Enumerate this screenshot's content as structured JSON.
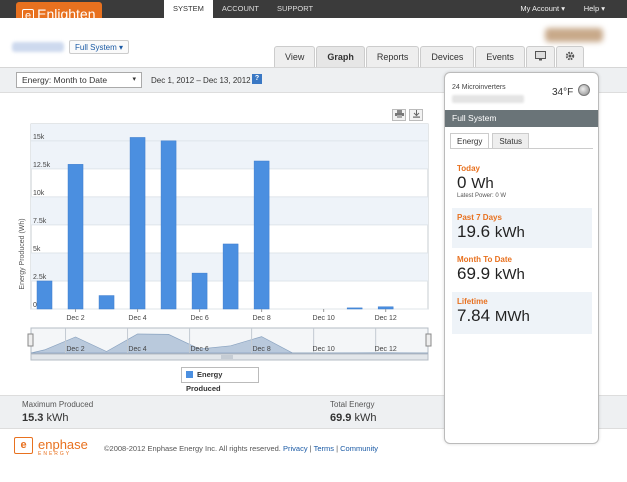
{
  "app": {
    "logo_bracket": "e",
    "logo_text": "Enlighten"
  },
  "nav": {
    "tabs": [
      "SYSTEM",
      "ACCOUNT",
      "SUPPORT"
    ],
    "active": 0,
    "my_account": "My Account ▾",
    "help": "Help ▾"
  },
  "header": {
    "system_menu": "Full System ▾"
  },
  "view_tabs": [
    "View",
    "Graph",
    "Reports",
    "Devices",
    "Events"
  ],
  "view_active": "Graph",
  "filter": {
    "energy_select": "Energy: Month to Date",
    "caret": "▾",
    "date_range": "Dec 1, 2012 – Dec 13, 2012",
    "help_icon": "?"
  },
  "legend": {
    "label": "Energy Produced"
  },
  "stats": {
    "max_label": "Maximum Produced",
    "max_value": "15.3",
    "max_unit": "kWh",
    "total_label": "Total Energy",
    "total_value": "69.9",
    "total_unit": "kWh"
  },
  "footer": {
    "logo_bracket": "e",
    "logo_text": "enphase",
    "logo_sub": "ENERGY",
    "copyright": "©2008-2012 Enphase Energy Inc. All rights reserved.",
    "privacy": "Privacy",
    "terms": "Terms",
    "community": "Community"
  },
  "right_panel": {
    "microinverters": "24 Microinverters",
    "temperature": "34°F",
    "title": "Full System",
    "tabs": [
      "Energy",
      "Status"
    ],
    "today_label": "Today",
    "today_value": "0",
    "today_unit": "Wh",
    "latest_power": "Latest Power: 0 W",
    "week_label": "Past 7 Days",
    "week_value": "19.6",
    "week_unit": "kWh",
    "month_label": "Month To Date",
    "month_value": "69.9",
    "month_unit": "kWh",
    "lifetime_label": "Lifetime",
    "lifetime_value": "7.84",
    "lifetime_unit": "MWh"
  },
  "colors": {
    "accent": "#e8711f",
    "bar": "#4b8fe0",
    "topbar": "#3b3b3b"
  },
  "chart_data": {
    "type": "bar",
    "ylabel": "Energy Produced (Wh)",
    "ylim": [
      0,
      16500
    ],
    "y_ticks": [
      0,
      2500,
      5000,
      7500,
      10000,
      12500,
      15000
    ],
    "y_tick_labels": [
      "0k",
      "2.5k",
      "5k",
      "7.5k",
      "10k",
      "12.5k",
      "15k"
    ],
    "categories": [
      "Dec 1",
      "Dec 2",
      "Dec 3",
      "Dec 4",
      "Dec 5",
      "Dec 6",
      "Dec 7",
      "Dec 8",
      "Dec 9",
      "Dec 10",
      "Dec 11",
      "Dec 12",
      "Dec 13"
    ],
    "x_tick_labels": [
      "Dec 2",
      "Dec 4",
      "Dec 6",
      "Dec 8",
      "Dec 10",
      "Dec 12"
    ],
    "values": [
      2500,
      12900,
      1200,
      15300,
      15000,
      3200,
      5800,
      13200,
      0,
      0,
      100,
      200,
      0
    ],
    "navigator_labels": [
      "Dec 2",
      "Dec 4",
      "Dec 6",
      "Dec 8",
      "Dec 10",
      "Dec 12"
    ]
  }
}
